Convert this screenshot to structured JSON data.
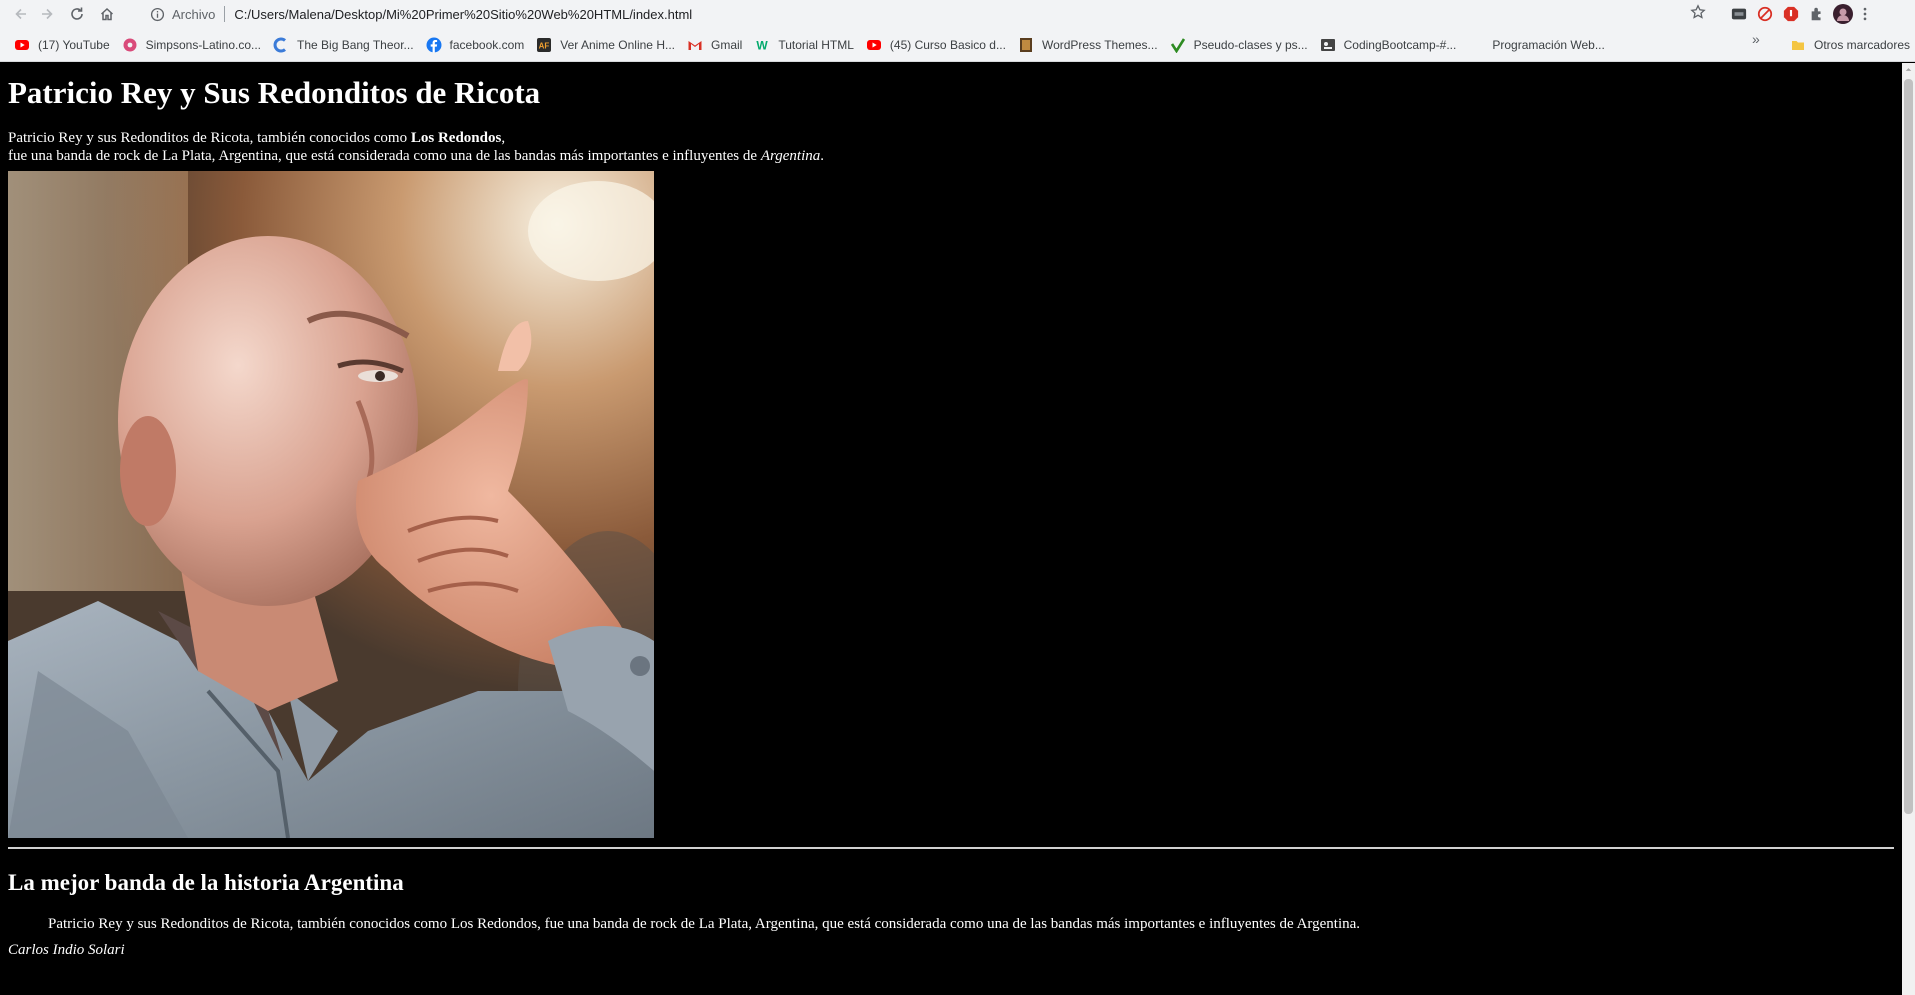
{
  "browser": {
    "scheme_label": "Archivo",
    "url": "C:/Users/Malena/Desktop/Mi%20Primer%20Sitio%20Web%20HTML/index.html",
    "bookmarks": [
      {
        "label": "(17) YouTube",
        "icon": "youtube-icon",
        "color": "#ff0000"
      },
      {
        "label": "Simpsons-Latino.co...",
        "icon": "simpsons-icon",
        "color": "#d94b7a"
      },
      {
        "label": "The Big Bang Theor...",
        "icon": "big-bang-icon",
        "color": "#3b7bd8"
      },
      {
        "label": "facebook.com",
        "icon": "facebook-icon",
        "color": "#1877f2"
      },
      {
        "label": "Ver Anime Online H...",
        "icon": "anime-icon",
        "color": "#2b2b2b"
      },
      {
        "label": "Gmail",
        "icon": "gmail-icon",
        "color": "#d93025"
      },
      {
        "label": "Tutorial HTML",
        "icon": "w3schools-icon",
        "color": "#04aa6d"
      },
      {
        "label": "(45) Curso Basico d...",
        "icon": "youtube-icon",
        "color": "#ff0000"
      },
      {
        "label": "WordPress Themes...",
        "icon": "wordpress-themes-icon",
        "color": "#5a3d1e"
      },
      {
        "label": "Pseudo-clases y ps...",
        "icon": "checkmark-icon",
        "color": "#2e8b22"
      },
      {
        "label": "CodingBootcamp-#...",
        "icon": "codingbootcamp-icon",
        "color": "#444444"
      },
      {
        "label": "Programación Web...",
        "icon": "none",
        "color": "#f2f3f5"
      }
    ],
    "other_bookmarks": "Otros marcadores"
  },
  "page": {
    "title": "Patricio Rey y Sus Redonditos de Ricota",
    "intro_before_bold": "Patricio Rey y sus Redonditos de Ricota, también conocidos como ",
    "intro_bold": "Los Redondos",
    "intro_after_bold": ",",
    "intro_line2_before": "fue una banda de rock de La Plata, Argentina, que está considerada como una de las bandas más importantes e influyentes de ",
    "intro_italic": "Argentina",
    "intro_line2_end": ".",
    "subtitle": "La mejor banda de la historia Argentina",
    "quote": "Patricio Rey y sus Redonditos de Ricota, también conocidos como Los Redondos, fue una banda de rock de La Plata, Argentina, que está considerada como una de las bandas más importantes e influyentes de Argentina.",
    "author": "Carlos Indio Solari"
  },
  "colors": {
    "page_background": "#000000",
    "page_text": "#ffffff",
    "chrome_background": "#f2f3f5"
  }
}
